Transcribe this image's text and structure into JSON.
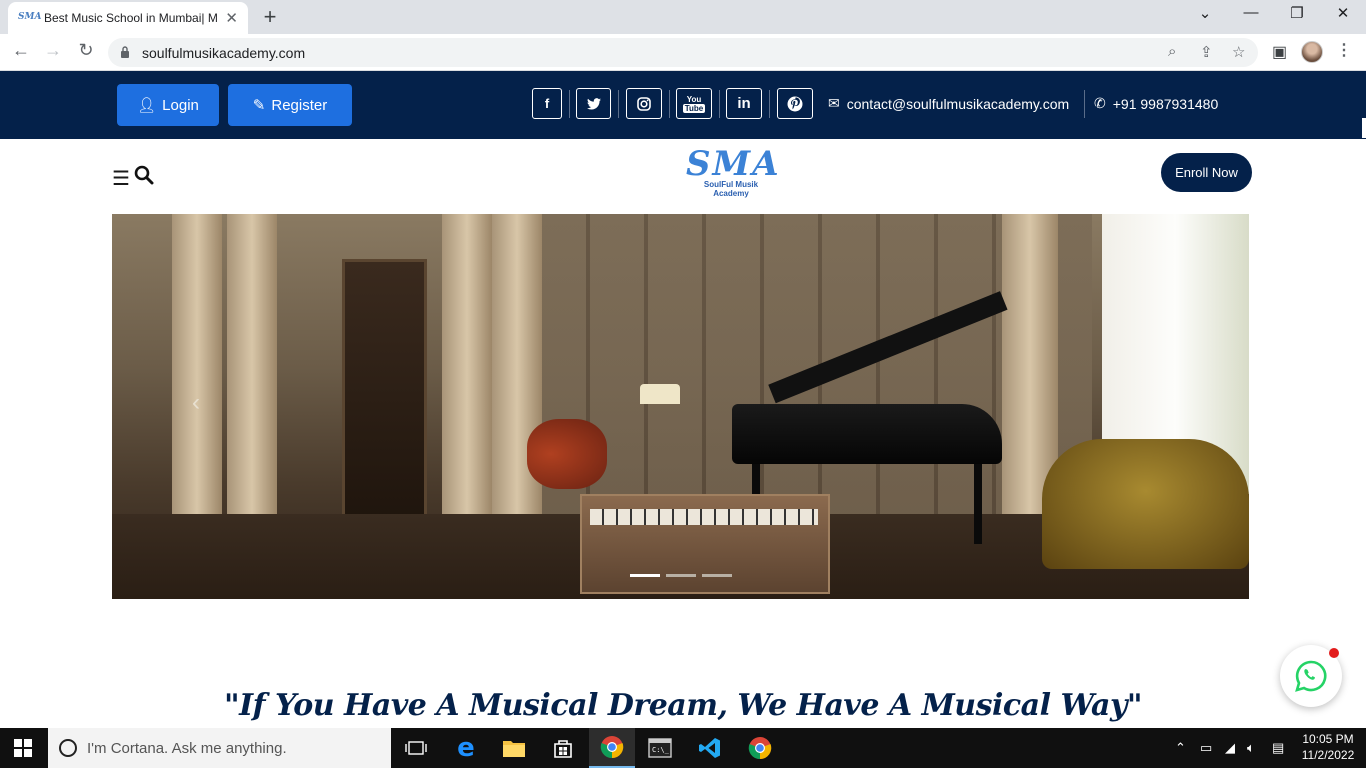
{
  "browser": {
    "tab_title": "Best Music School in Mumbai| M",
    "tab_favicon_text": "SMA",
    "url": "soulfulmusikacademy.com"
  },
  "topbar": {
    "login_label": "Login",
    "register_label": "Register",
    "social_icons": [
      "facebook-icon",
      "twitter-icon",
      "instagram-icon",
      "youtube-icon",
      "linkedin-icon",
      "pinterest-icon"
    ],
    "email": "contact@soulfulmusikacademy.com",
    "phone": "+91 9987931480"
  },
  "header": {
    "logo_mark": "SMA",
    "logo_text": "SoulFul Musik Academy",
    "enroll_label": "Enroll Now"
  },
  "hero": {
    "slide_count": 3,
    "active_slide": 1
  },
  "tagline": "\"If You Have A Musical Dream, We Have A Musical Way\"",
  "taskbar": {
    "cortana_placeholder": "I'm Cortana. Ask me anything.",
    "time": "10:05 PM",
    "date": "11/2/2022"
  },
  "colors": {
    "navy": "#04214a",
    "button_blue": "#1e6fe0",
    "whatsapp_green": "#25d366"
  }
}
